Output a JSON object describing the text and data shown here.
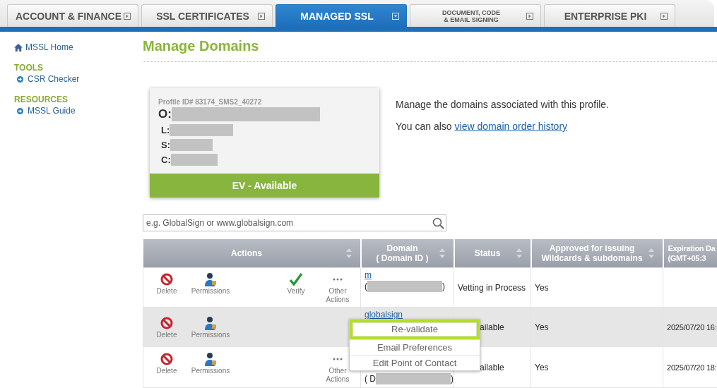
{
  "tabs": [
    {
      "label": "ACCOUNT & FINANCE",
      "selected": false,
      "small": false
    },
    {
      "label": "SSL CERTIFICATES",
      "selected": false,
      "small": false
    },
    {
      "label": "MANAGED SSL",
      "selected": true,
      "small": false
    },
    {
      "label": "DOCUMENT, CODE\n& EMAIL SIGNING",
      "selected": false,
      "small": true
    },
    {
      "label": "ENTERPRISE PKI",
      "selected": false,
      "small": false
    }
  ],
  "sidebar": [
    {
      "kind": "home",
      "label": "MSSL Home"
    },
    {
      "kind": "heading",
      "label": "TOOLS"
    },
    {
      "kind": "link",
      "label": "CSR Checker"
    },
    {
      "kind": "heading",
      "label": "RESOURCES"
    },
    {
      "kind": "link",
      "label": "MSSL Guide"
    }
  ],
  "page_title": "Manage Domains",
  "profile": {
    "profile_id": "Profile ID# 83174_SMS2_40272",
    "fields": [
      {
        "label": "O:",
        "redacted": true
      },
      {
        "label": "L:",
        "redacted": true
      },
      {
        "label": "S:",
        "redacted": true
      },
      {
        "label": "C:",
        "redacted": true
      }
    ],
    "badge": "EV - Available"
  },
  "intro": "Manage the domains associated with this profile.",
  "history": {
    "text": "You can also ",
    "link": "view domain order history"
  },
  "search": {
    "placeholder": "e.g. GlobalSign or www.globalsign.com"
  },
  "table": {
    "columns": [
      "Actions",
      "Domain\n( Domain ID )",
      "Status",
      "Approved for issuing\nWildcards & subdomains",
      "Expiration Da\n(GMT+05:3"
    ],
    "rows": [
      {
        "selected": false,
        "actions": [
          {
            "kind": "delete",
            "label": "Delete"
          },
          {
            "kind": "permissions",
            "label": "Permissions"
          },
          {
            "kind": "verify",
            "label": "Verify"
          },
          {
            "kind": "other",
            "label": "Other\nActions"
          }
        ],
        "domain": "m",
        "domain_id": "(",
        "domain_id_end": ")",
        "status": "Vetting in Process",
        "approved": "Yes",
        "expiration": ""
      },
      {
        "selected": true,
        "actions": [
          {
            "kind": "delete",
            "label": "Delete"
          },
          {
            "kind": "permissions",
            "label": "Permissions"
          }
        ],
        "domain": "globalsign",
        "domain_id": "",
        "domain_id_end": "",
        "status": "ailable",
        "approved": "Yes",
        "expiration": "2025/07/20 16:"
      },
      {
        "selected": false,
        "actions": [
          {
            "kind": "delete",
            "label": "Delete"
          },
          {
            "kind": "permissions",
            "label": "Permissions"
          },
          {
            "kind": "other",
            "label": "Other\nActions"
          }
        ],
        "domain": "",
        "domain_id": "( D",
        "domain_id_end": ")",
        "status": "ailable",
        "approved": "Yes",
        "expiration": "2025/07/20 18:"
      }
    ]
  },
  "menu": {
    "items": [
      {
        "label": "Re-validate",
        "selected": true
      },
      {
        "label": "Email Preferences",
        "selected": false
      },
      {
        "label": "Edit Point of Contact",
        "selected": false
      }
    ]
  }
}
